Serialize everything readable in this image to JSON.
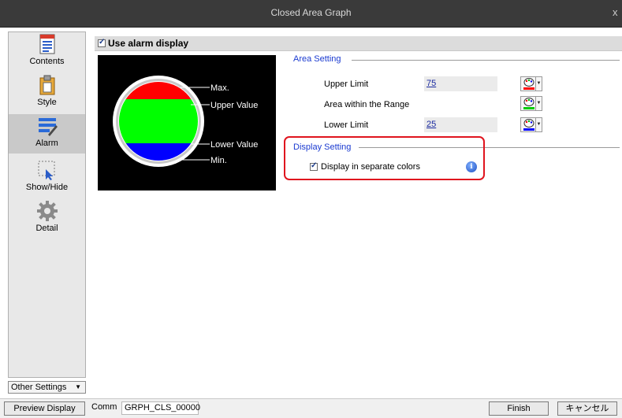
{
  "window": {
    "title": "Closed Area Graph",
    "close_label": "x"
  },
  "sidebar": {
    "items": [
      {
        "label": "Contents",
        "icon": "contents-icon"
      },
      {
        "label": "Style",
        "icon": "style-icon"
      },
      {
        "label": "Alarm",
        "icon": "alarm-icon",
        "selected": true
      },
      {
        "label": "Show/Hide",
        "icon": "show-hide-icon"
      },
      {
        "label": "Detail",
        "icon": "detail-icon"
      }
    ],
    "other_settings": "Other Settings"
  },
  "header": {
    "use_alarm_label": "Use alarm display",
    "checked": true
  },
  "preview": {
    "labels": {
      "max": "Max.",
      "upper": "Upper Value",
      "lower": "Lower Value",
      "min": "Min."
    },
    "colors": {
      "upper": "#ff0000",
      "range": "#00ff00",
      "lower": "#0000ff"
    }
  },
  "area_setting": {
    "title": "Area Setting",
    "upper_limit": {
      "label": "Upper Limit",
      "value": "75",
      "color": "#ff0000"
    },
    "range": {
      "label": "Area within the Range",
      "color": "#00cc00"
    },
    "lower_limit": {
      "label": "Lower Limit",
      "value": "25",
      "color": "#0000ff"
    }
  },
  "display_setting": {
    "title": "Display Setting",
    "separate_colors_label": "Display in separate colors",
    "checked": true
  },
  "footer": {
    "preview_button": "Preview Display",
    "comm_label": "Comm",
    "comm_value": "GRPH_CLS_00000",
    "finish_button": "Finish",
    "cancel_button": "キャンセル"
  }
}
